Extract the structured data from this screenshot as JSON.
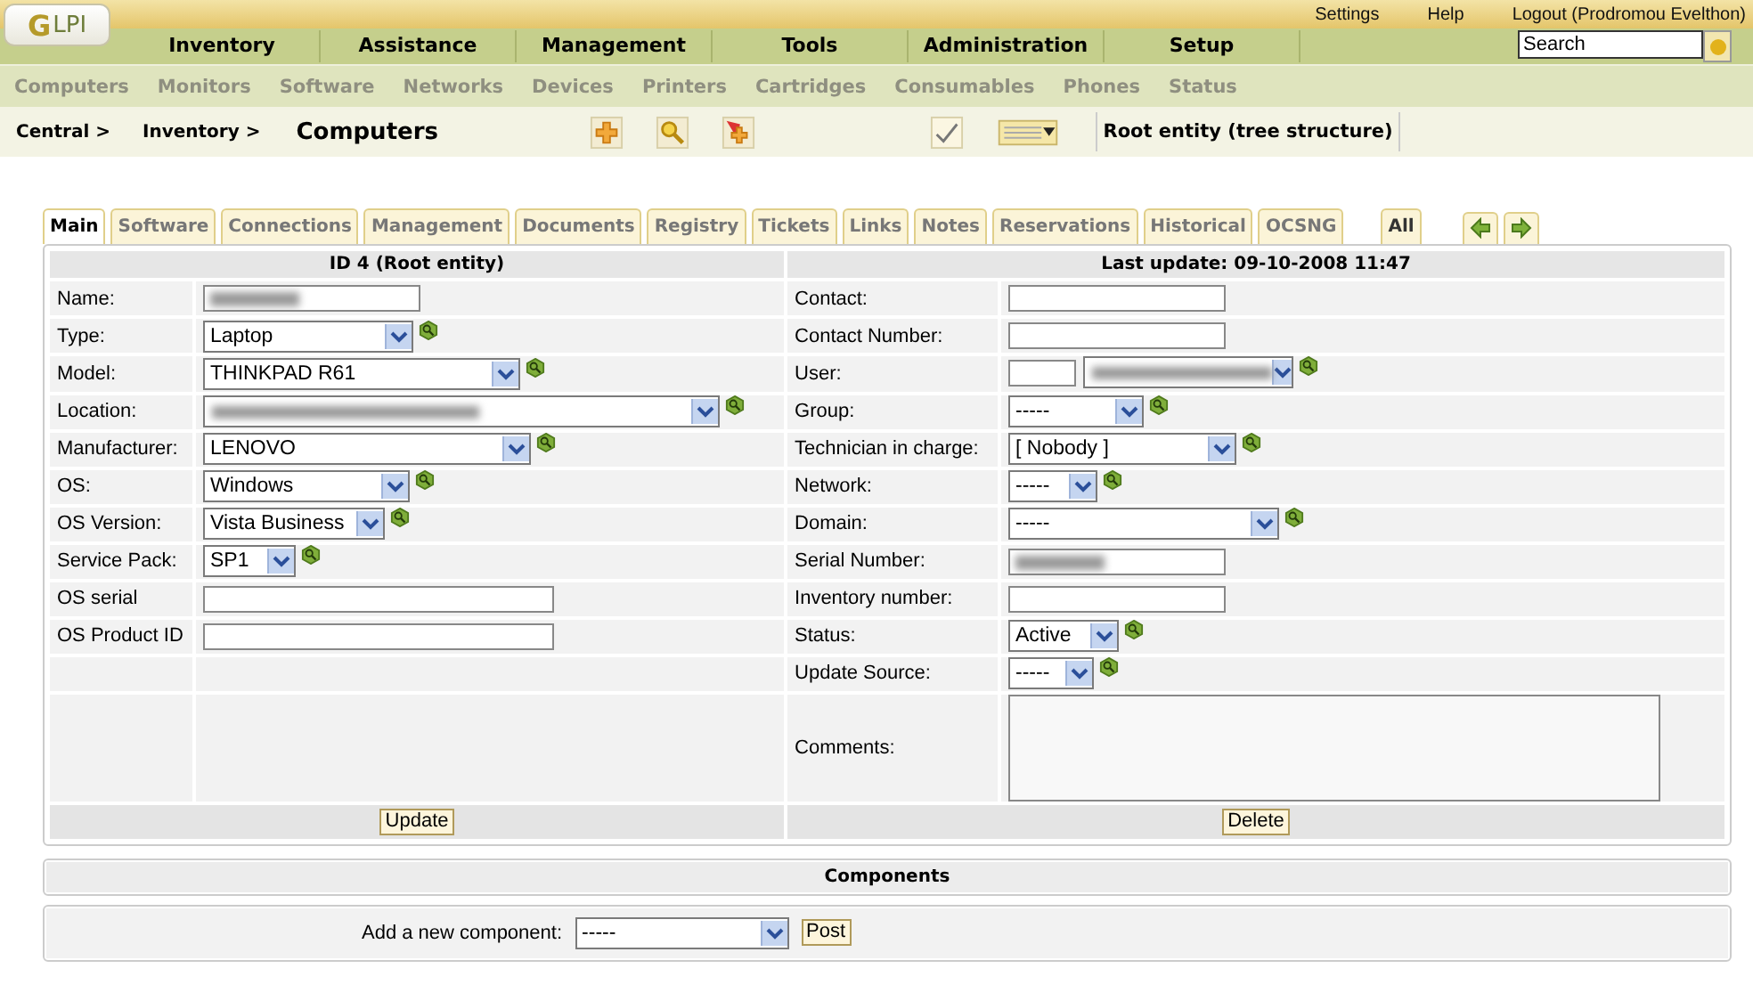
{
  "logo_mark": "G",
  "logo": "LPI",
  "top_links": [
    "Settings",
    "Help",
    "Logout (Prodromou Evelthon)"
  ],
  "menu": [
    {
      "label": "Inventory"
    },
    {
      "label": "Assistance"
    },
    {
      "label": "Management"
    },
    {
      "label": "Tools"
    },
    {
      "label": "Administration"
    },
    {
      "label": "Setup"
    }
  ],
  "search": {
    "placeholder": "Search"
  },
  "submenu": [
    "Computers",
    "Monitors",
    "Software",
    "Networks",
    "Devices",
    "Printers",
    "Cartridges",
    "Consumables",
    "Phones",
    "Status"
  ],
  "breadcrumb": [
    "Central >",
    "Inventory >"
  ],
  "page_title": "Computers",
  "entity": "Root entity (tree structure)",
  "tabs": [
    {
      "label": "Main",
      "selected": true
    },
    {
      "label": "Software",
      "selected": false
    },
    {
      "label": "Connections",
      "selected": false
    },
    {
      "label": "Management",
      "selected": false
    },
    {
      "label": "Documents",
      "selected": false
    },
    {
      "label": "Registry",
      "selected": false
    },
    {
      "label": "Tickets",
      "selected": false
    },
    {
      "label": "Links",
      "selected": false
    },
    {
      "label": "Notes",
      "selected": false
    },
    {
      "label": "Reservations",
      "selected": false
    },
    {
      "label": "Historical",
      "selected": false
    },
    {
      "label": "OCSNG",
      "selected": false
    }
  ],
  "all_tab": "All",
  "left_header": "ID 4 (Root entity)",
  "right_header": "Last update: 09-10-2008 11:47",
  "left_fields": [
    {
      "label": "Name:",
      "kind": "text",
      "redacted": true
    },
    {
      "label": "Type:",
      "kind": "select",
      "value": "Laptop"
    },
    {
      "label": "Model:",
      "kind": "select",
      "value": "THINKPAD R61"
    },
    {
      "label": "Location:",
      "kind": "select",
      "redacted": true
    },
    {
      "label": "Manufacturer:",
      "kind": "select",
      "value": "LENOVO"
    },
    {
      "label": "OS:",
      "kind": "select",
      "value": "Windows"
    },
    {
      "label": "OS Version:",
      "kind": "select",
      "value": "Vista Business"
    },
    {
      "label": "Service Pack:",
      "kind": "select",
      "value": "SP1"
    },
    {
      "label": "OS serial",
      "kind": "text"
    },
    {
      "label": "OS Product ID",
      "kind": "text"
    }
  ],
  "right_fields": [
    {
      "label": "Contact:",
      "kind": "text"
    },
    {
      "label": "Contact Number:",
      "kind": "text"
    },
    {
      "label": "User:",
      "kind": "user",
      "redacted": true
    },
    {
      "label": "Group:",
      "kind": "select",
      "value": "-----"
    },
    {
      "label": "Technician in charge:",
      "kind": "select",
      "value": "[ Nobody ]"
    },
    {
      "label": "Network:",
      "kind": "select",
      "value": "-----"
    },
    {
      "label": "Domain:",
      "kind": "select",
      "value": "-----"
    },
    {
      "label": "Serial Number:",
      "kind": "text",
      "redacted": true
    },
    {
      "label": "Inventory number:",
      "kind": "text"
    },
    {
      "label": "Status:",
      "kind": "select",
      "value": "Active"
    },
    {
      "label": "Update Source:",
      "kind": "select",
      "value": "-----"
    },
    {
      "label": "Comments:",
      "kind": "textarea"
    }
  ],
  "update_button": "Update",
  "delete_button": "Delete",
  "components_header": "Components",
  "add_component": {
    "label": "Add a new component:",
    "value": "-----",
    "button": "Post"
  }
}
